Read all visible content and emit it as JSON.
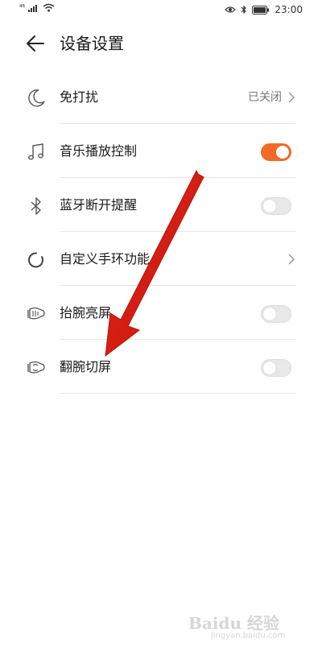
{
  "status_bar": {
    "network": "⁴⁶",
    "time": "23:00"
  },
  "header": {
    "title": "设备设置",
    "back_icon": "back-arrow-icon"
  },
  "settings": [
    {
      "id": "dnd",
      "label": "免打扰",
      "icon": "moon-icon",
      "control": "value",
      "value": "已关闭"
    },
    {
      "id": "music",
      "label": "音乐播放控制",
      "icon": "music-note-icon",
      "control": "toggle",
      "on": true
    },
    {
      "id": "bt",
      "label": "蓝牙断开提醒",
      "icon": "bluetooth-icon",
      "control": "toggle",
      "on": false
    },
    {
      "id": "custom",
      "label": "自定义手环功能",
      "icon": "circle-refresh-icon",
      "control": "chevron"
    },
    {
      "id": "raise",
      "label": "抬腕亮屏",
      "icon": "wrist-raise-icon",
      "control": "toggle",
      "on": false
    },
    {
      "id": "flip",
      "label": "翻腕切屏",
      "icon": "wrist-flip-icon",
      "control": "toggle",
      "on": false
    }
  ],
  "colors": {
    "accent": "#f26a24",
    "annotation_arrow": "#e0231a"
  },
  "watermark": {
    "brand": "Baidu 经验",
    "url": "jingyan.baidu.com"
  }
}
